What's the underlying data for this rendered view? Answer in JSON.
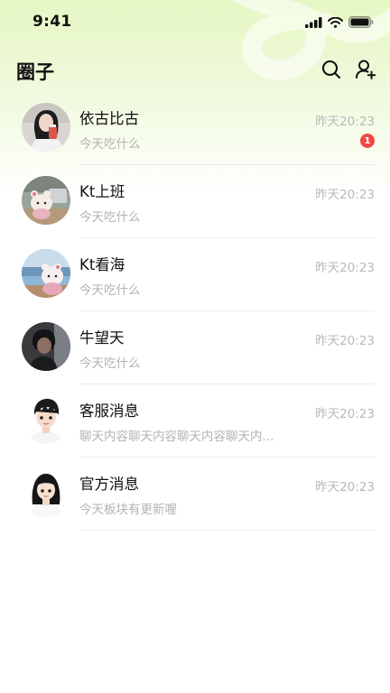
{
  "status_bar": {
    "time": "9:41"
  },
  "header": {
    "title": "圈子"
  },
  "conversations": [
    {
      "name": "依古比古",
      "preview": "今天吃什么",
      "time": "昨天20:23",
      "unread": "1",
      "avatar": "photo-girl-with-drink"
    },
    {
      "name": "Kt上班",
      "preview": "今天吃什么",
      "time": "昨天20:23",
      "avatar": "photo-plush-at-desk"
    },
    {
      "name": "Kt看海",
      "preview": "今天吃什么",
      "time": "昨天20:23",
      "avatar": "photo-plush-by-sea"
    },
    {
      "name": "牛望天",
      "preview": "今天吃什么",
      "time": "昨天20:23",
      "avatar": "photo-dark-portrait"
    },
    {
      "name": "客服消息",
      "preview": "聊天内容聊天内容聊天内容聊天内...",
      "time": "昨天20:23",
      "avatar": "cartoon-boy"
    },
    {
      "name": "官方消息",
      "preview": "今天板块有更新喔",
      "time": "昨天20:23",
      "avatar": "cartoon-girl"
    }
  ],
  "colors": {
    "accent_bg": "#e6f7c4",
    "badge": "#f04848",
    "muted_text": "#b3b3b3"
  },
  "icons": {
    "search": "search-icon",
    "add_user": "add-user-icon"
  }
}
